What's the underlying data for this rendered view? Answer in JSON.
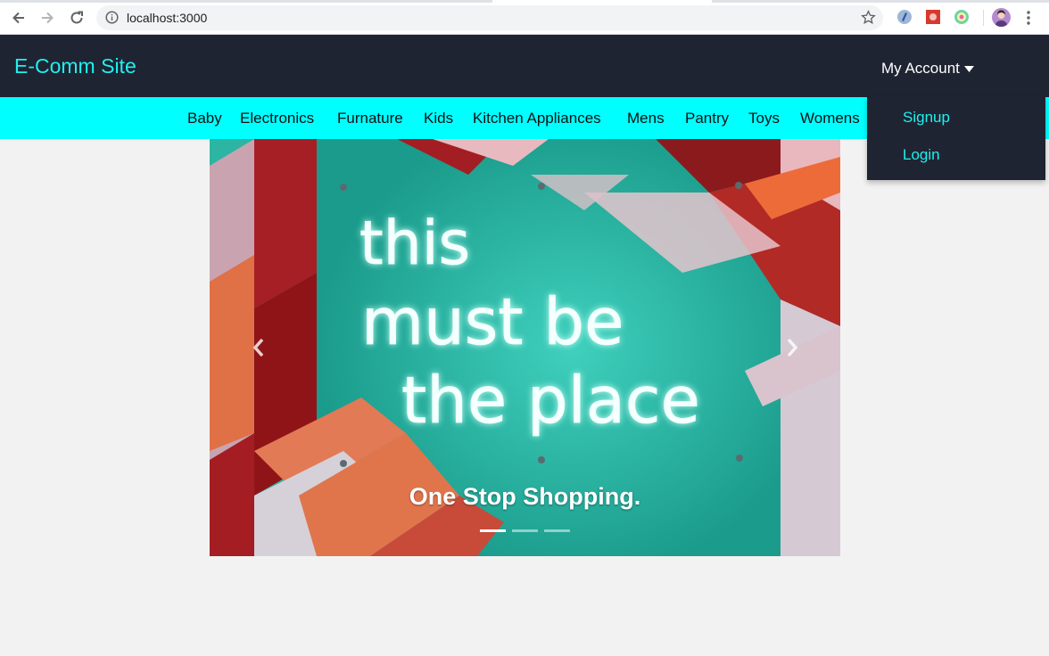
{
  "browser": {
    "url": "localhost:3000"
  },
  "site": {
    "brand": "E-Comm Site",
    "account_label": "My Account"
  },
  "categories": [
    "Baby",
    "Electronics",
    "Furnature",
    "Kids",
    "Kitchen Appliances",
    "Mens",
    "Pantry",
    "Toys",
    "Womens"
  ],
  "dropdown": {
    "items": [
      "Signup",
      "Login"
    ]
  },
  "carousel": {
    "caption": "One Stop Shopping.",
    "neon_lines": [
      "this",
      "must be",
      "the place"
    ],
    "slide_count": 3,
    "active_slide": 1
  },
  "colors": {
    "header_bg": "#1f2433",
    "accent_cyan": "#00ffff",
    "brand_text": "#1ff0ee",
    "page_bg": "#f2f2f2"
  }
}
